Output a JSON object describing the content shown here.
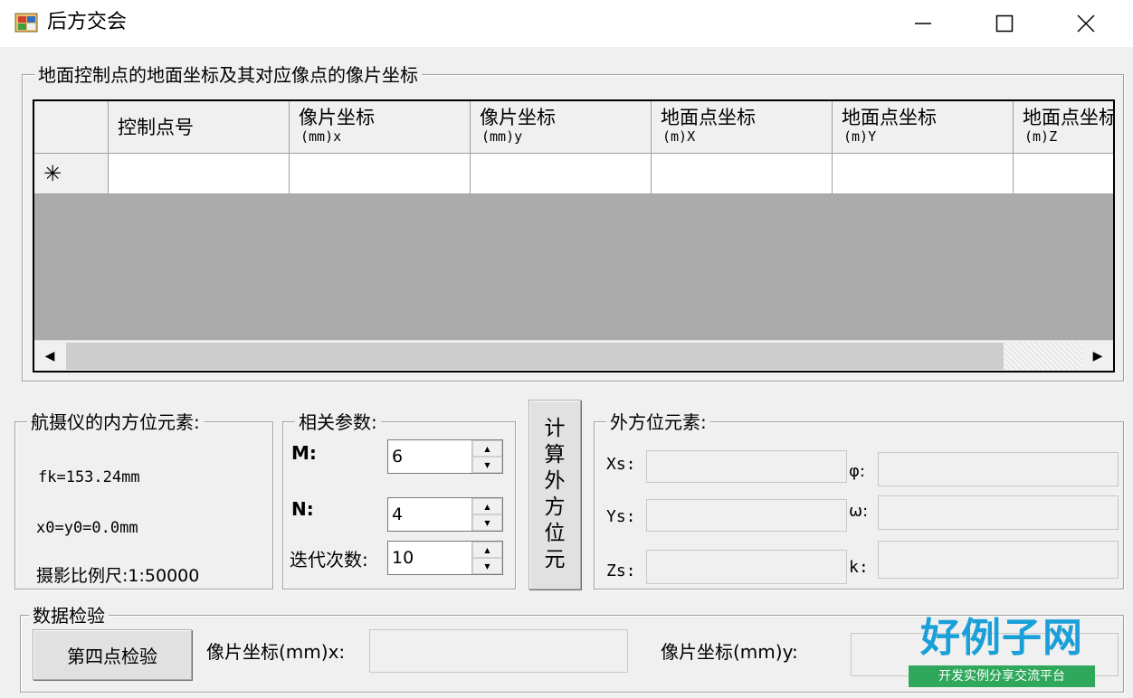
{
  "window": {
    "title": "后方交会",
    "min_glyph": "—",
    "max_glyph": "☐",
    "close_glyph": "✕"
  },
  "control_group": {
    "title": "地面控制点的地面坐标及其对应像点的像片坐标",
    "columns": [
      {
        "line1": "控制点号",
        "line2": ""
      },
      {
        "line1": "像片坐标",
        "line2": "(mm)x"
      },
      {
        "line1": "像片坐标",
        "line2": "(mm)y"
      },
      {
        "line1": "地面点坐标",
        "line2": "(m)X"
      },
      {
        "line1": "地面点坐标",
        "line2": "(m)Y"
      },
      {
        "line1": "地面点坐标",
        "line2": "(m)Z"
      }
    ],
    "new_row_marker": "✳",
    "scroll_left": "◀",
    "scroll_right": "▶"
  },
  "camera_group": {
    "title": "航摄仪的内方位元素:",
    "fk": "fk=153.24mm",
    "principal": "x0=y0=0.0mm",
    "scale": "摄影比例尺:1:50000"
  },
  "params_group": {
    "title": "相关参数:",
    "m_label": "M:",
    "m_value": "6",
    "n_label": "N:",
    "n_value": "4",
    "iter_label": "迭代次数:",
    "iter_value": "10",
    "up_glyph": "▲",
    "down_glyph": "▼"
  },
  "compute_button": {
    "label_chars": [
      "计",
      "算",
      "外",
      "方",
      "位",
      "元"
    ]
  },
  "exterior_group": {
    "title": "外方位元素:",
    "xs_label": "Xs:",
    "ys_label": "Ys:",
    "zs_label": "Zs:",
    "phi_label": "φ:",
    "omega_label": "ω:",
    "k_label": "k:"
  },
  "check_group": {
    "title": "数据检验",
    "button_label": "第四点检验",
    "x_label": "像片坐标(mm)x:",
    "y_label": "像片坐标(mm)y:"
  },
  "watermark": {
    "title": "好例子网",
    "subtitle": "开发实例分享交流平台"
  },
  "colors": {
    "window_bg": "#f0f0f0",
    "grid_empty": "#ababab",
    "watermark_blue": "#1aa0d8",
    "watermark_green": "#2fa85c"
  }
}
